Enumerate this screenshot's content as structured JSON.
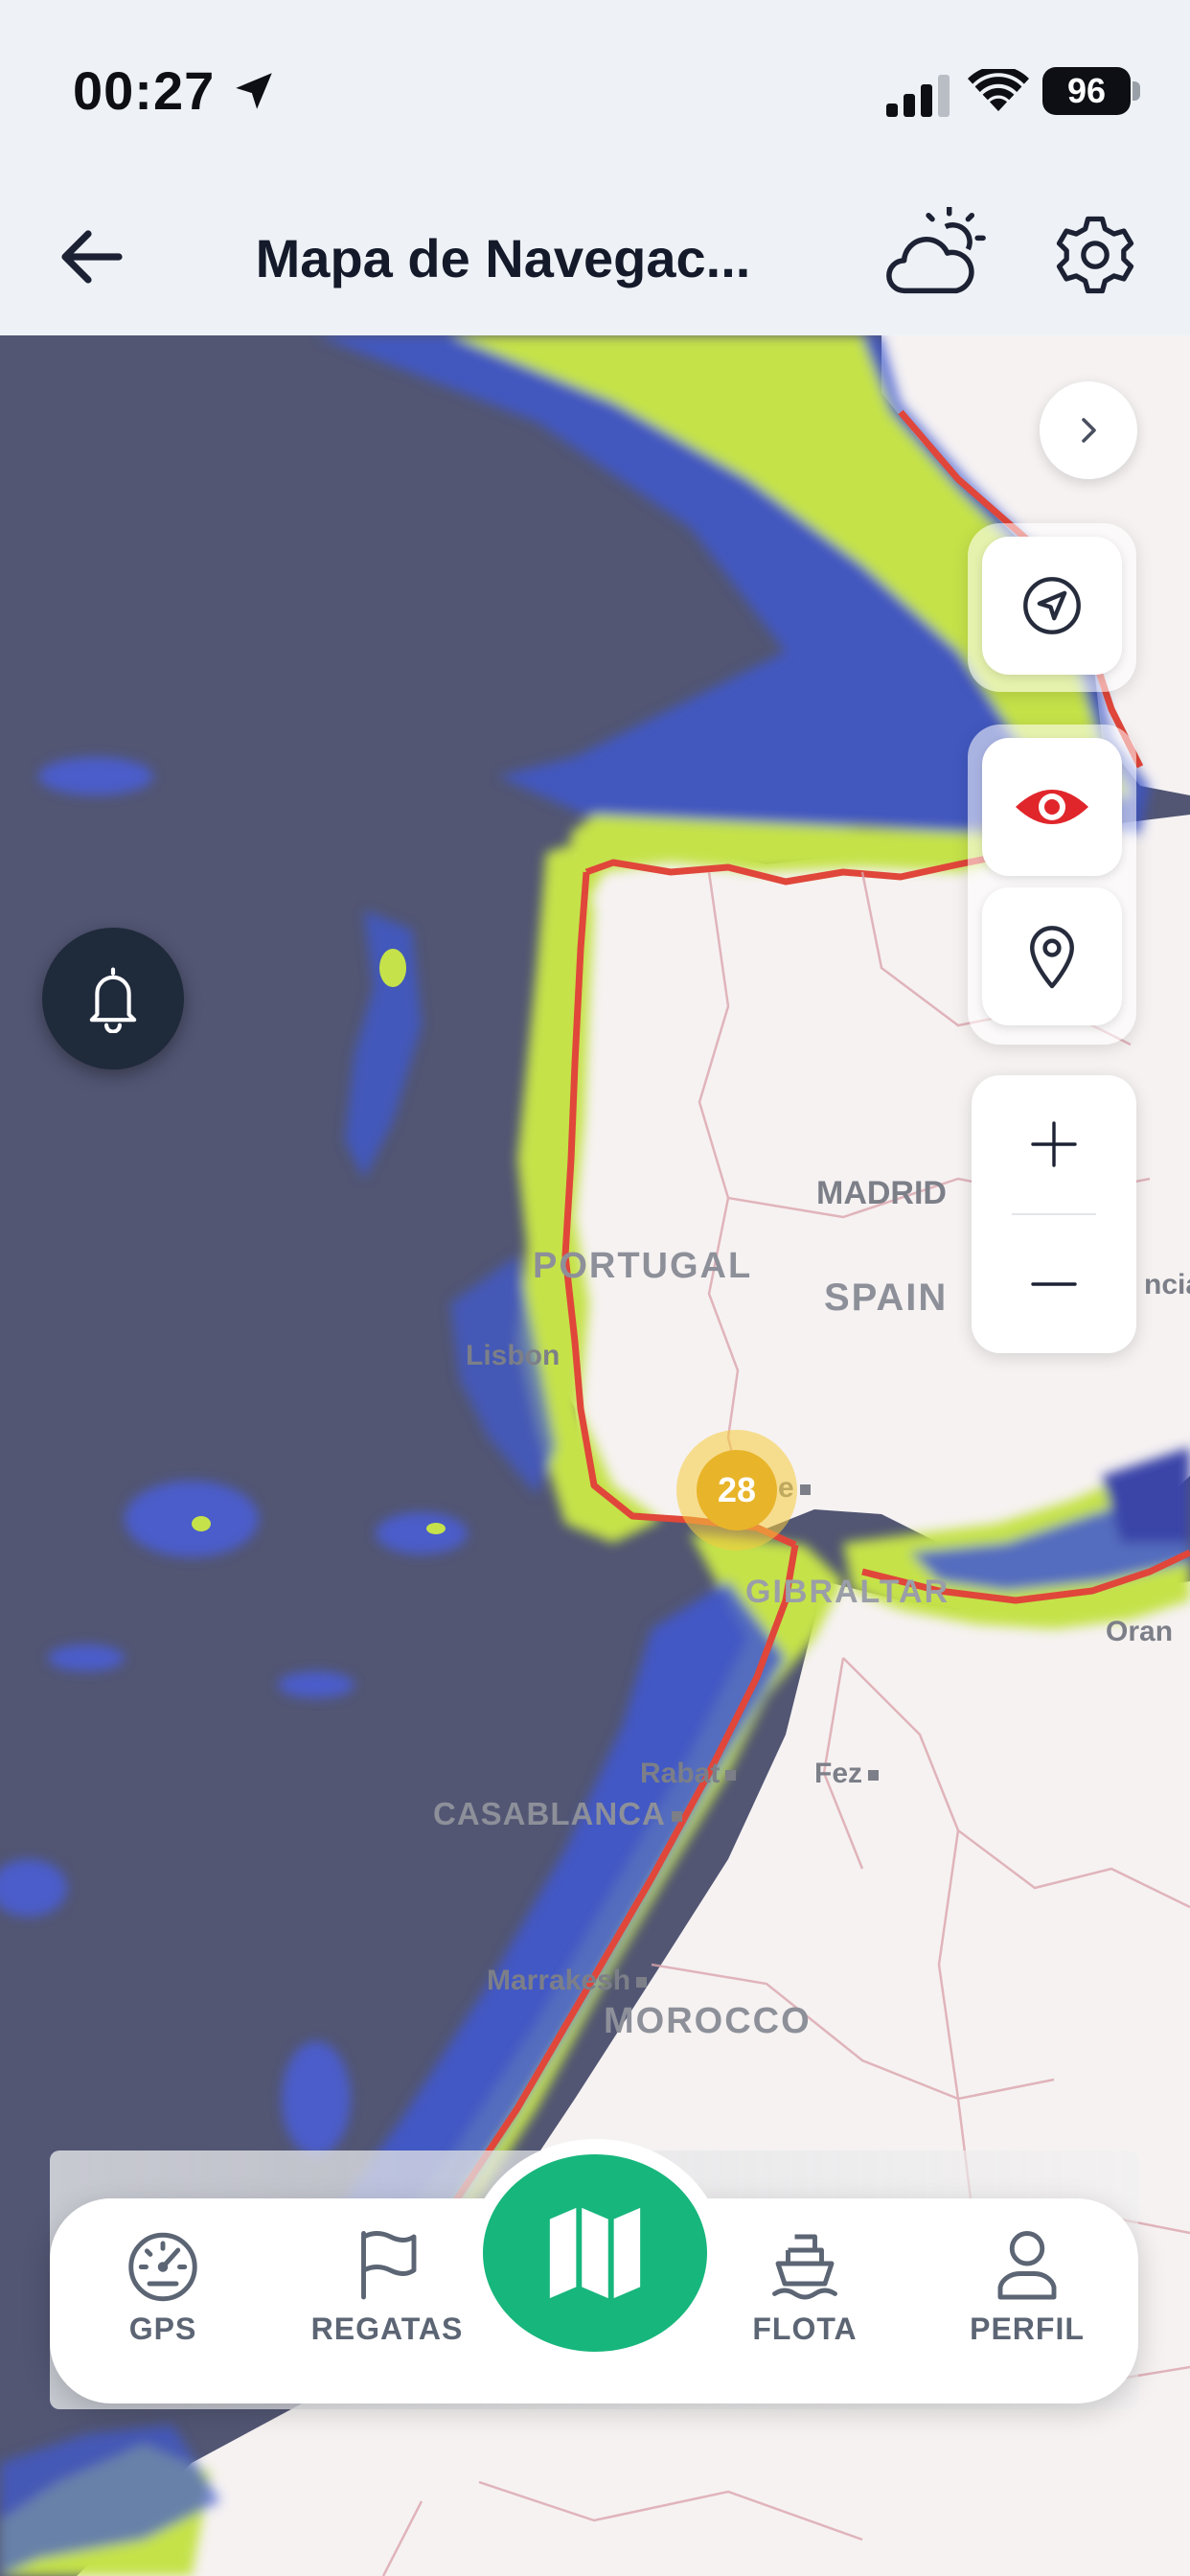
{
  "status_bar": {
    "time": "00:27",
    "battery": "96",
    "icons": [
      "location-arrow-icon",
      "signal-icon",
      "wifi-icon",
      "battery-icon"
    ]
  },
  "header": {
    "title": "Mapa de Navegac...",
    "back_icon": "arrow-left-icon",
    "weather_icon": "partly-cloudy-icon",
    "settings_icon": "gear-icon"
  },
  "map": {
    "region_labels": {
      "portugal": "PORTUGAL",
      "spain": "SPAIN",
      "morocco": "MOROCCO",
      "gibraltar": "GIBRALTAR"
    },
    "city_labels": {
      "madrid": "MADRID",
      "lisbon": "Lisbon",
      "rabat": "Rabat",
      "fez": "Fez",
      "casablanca": "CASABLANCA",
      "marrakesh": "Marrakesh",
      "oran": "Oran",
      "valencia_partial": "ncia",
      "seville_partial": "e"
    },
    "cluster_count": "28",
    "controls": {
      "expand_icon": "chevron-right-icon",
      "navigate_icon": "navigation-arrow-icon",
      "visibility_icon": "eye-icon",
      "pin_icon": "map-pin-icon",
      "zoom_in_icon": "plus-icon",
      "zoom_out_icon": "minus-icon",
      "alert_icon": "bell-icon"
    },
    "colors": {
      "deep_sea": "#525673",
      "shallow_blue": "#4a5bd6",
      "coastal_green": "#c8e34a",
      "coast_red": "#e0463a",
      "land": "#f6f2f2",
      "eye_red": "#e0262b"
    }
  },
  "tabs": [
    {
      "label": "GPS",
      "icon": "gauge-icon"
    },
    {
      "label": "REGATAS",
      "icon": "flag-icon"
    },
    {
      "label": "",
      "icon": "map-icon"
    },
    {
      "label": "FLOTA",
      "icon": "boat-icon"
    },
    {
      "label": "PERFIL",
      "icon": "user-icon"
    }
  ],
  "accent_color": "#17b67c"
}
